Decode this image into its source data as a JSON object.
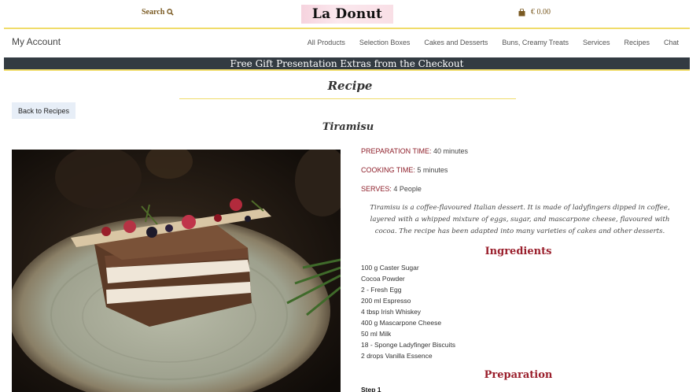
{
  "header": {
    "search_label": "Search",
    "logo_text": "La Donut",
    "cart_amount": "€ 0.00"
  },
  "nav": {
    "account": "My Account",
    "links": [
      "All Products",
      "Selection Boxes",
      "Cakes and Desserts",
      "Buns, Creamy Treats",
      "Services",
      "Recipes",
      "Chat"
    ]
  },
  "promo": "Free Gift Presentation Extras from the Checkout",
  "page": {
    "title": "Recipe",
    "back_button": "Back to Recipes",
    "recipe_name": "Tiramisu"
  },
  "recipe": {
    "prep_label": "PREPARATION TIME:",
    "prep_value": "40 minutes",
    "cook_label": "COOKING TIME:",
    "cook_value": "5 minutes",
    "serves_label": "SERVES:",
    "serves_value": "4 People",
    "description": "Tiramisu is a coffee-flavoured Italian dessert. It is made of ladyfingers dipped in coffee, layered with a whipped mixture of eggs, sugar, and mascarpone cheese, flavoured with cocoa. The recipe has been adapted into many varieties of cakes and other desserts.",
    "ingredients_heading": "Ingredients",
    "ingredients": [
      "100 g Caster Sugar",
      "Cocoa Powder",
      "2 - Fresh Egg",
      "200 ml Espresso",
      "4 tbsp Irish Whiskey",
      "400 g Mascarpone Cheese",
      "50 ml Milk",
      "18 - Sponge Ladyfinger Biscuits",
      "2 drops Vanilla Essence"
    ],
    "preparation_heading": "Preparation",
    "first_step": "Step 1"
  },
  "colors": {
    "accent_yellow": "#f0dc6a",
    "label_red": "#8e1f2a",
    "promo_bg": "#333b42"
  }
}
